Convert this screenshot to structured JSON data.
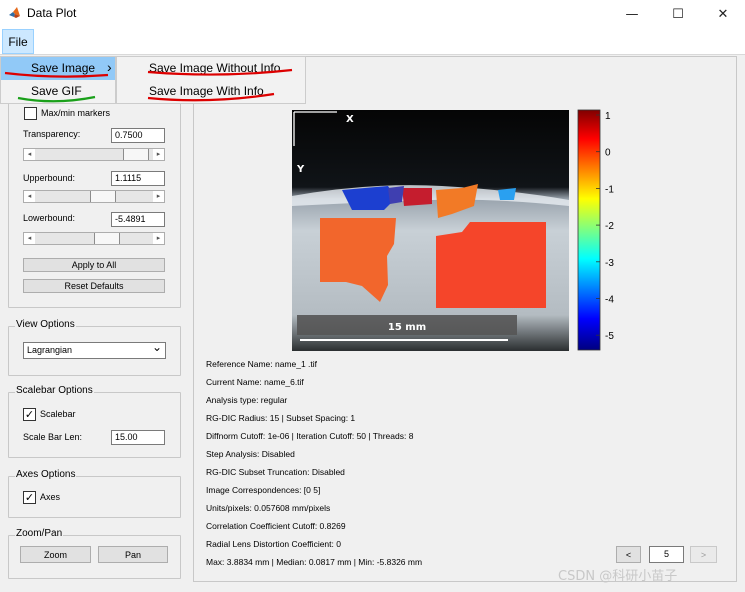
{
  "window": {
    "title": "Data Plot",
    "minimize": "—",
    "maximize": "☐",
    "close": "✕"
  },
  "menu": {
    "file": "File"
  },
  "file_menu": {
    "save_image": "Save Image",
    "save_gif": "Save GIF",
    "submenu_arrow": "›",
    "submenu": {
      "without_info": "Save Image Without Info",
      "with_info": "Save Image With Info"
    }
  },
  "display": {
    "maxmin_markers": "Max/min markers",
    "transparency_label": "Transparency:",
    "transparency_value": "0.7500",
    "upperbound_label": "Upperbound:",
    "upperbound_value": "1.1115",
    "lowerbound_label": "Lowerbound:",
    "lowerbound_value": "-5.4891",
    "apply_all": "Apply to All",
    "reset_defaults": "Reset Defaults",
    "arrow_left": "◂",
    "arrow_right": "▸"
  },
  "view_options": {
    "title": "View Options",
    "selected": "Lagrangian",
    "chevron": "⌄"
  },
  "scalebar_options": {
    "title": "Scalebar Options",
    "scalebar_label": "Scalebar",
    "scalebar_checked": "✓",
    "len_label": "Scale Bar Len:",
    "len_value": "15.00"
  },
  "axes_options": {
    "title": "Axes Options",
    "axes_label": "Axes",
    "axes_checked": "✓"
  },
  "zoom_pan": {
    "title": "Zoom/Pan",
    "zoom": "Zoom",
    "pan": "Pan"
  },
  "plot": {
    "x_axis": "X",
    "y_axis": "Y",
    "scalebar_text": "15 mm",
    "colorbar_ticks": [
      "1",
      "0",
      "-1",
      "-2",
      "-3",
      "-4",
      "-5"
    ]
  },
  "info": [
    "Reference Name: name_1 .tif",
    "Current Name: name_6.tif",
    "Analysis type: regular",
    "RG-DIC Radius: 15 | Subset Spacing: 1",
    "Diffnorm Cutoff: 1e-06 | Iteration Cutoff: 50 | Threads: 8",
    "Step Analysis: Disabled",
    "RG-DIC Subset Truncation: Disabled",
    "Image Correspondences: [0 5]",
    "Units/pixels: 0.057608 mm/pixels",
    "Correlation Coefficient Cutoff: 0.8269",
    "Radial Lens Distortion Coefficient: 0",
    "Max: 3.8834 mm | Median: 0.0817 mm | Min: -5.8326 mm"
  ],
  "pager": {
    "prev": "<",
    "value": "5",
    "next": ">"
  },
  "watermark": "CSDN @科研小苗子"
}
